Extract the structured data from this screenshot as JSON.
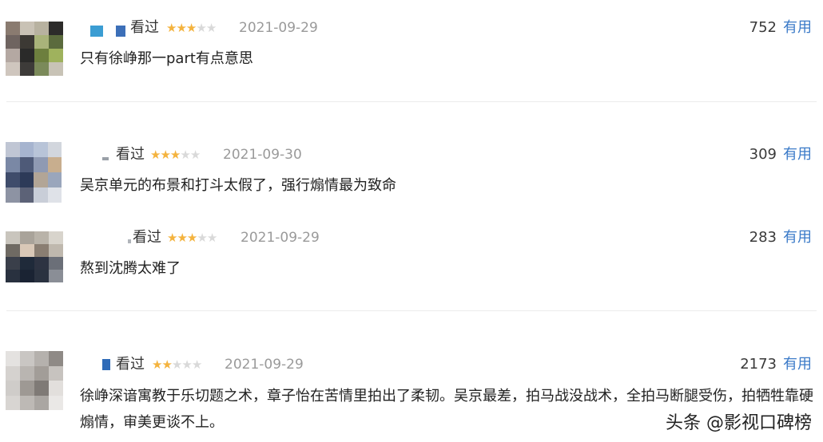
{
  "reviews": [
    {
      "status": "看过",
      "rating": 3,
      "max_rating": 5,
      "date": "2021-09-29",
      "votes": "752",
      "useful_label": "有用",
      "content": "只有徐峥那一part有点意思",
      "avatar_colors": [
        "#8a7b70",
        "#c9c2b5",
        "#b8b2a0",
        "#2c2b2a",
        "#6f6460",
        "#3c3934",
        "#a9b37a",
        "#5b6b3d",
        "#b4a8a2",
        "#2a2a29",
        "#6d7f3e",
        "#9fb25d",
        "#cfc6be",
        "#3d3b39",
        "#7b8a5a",
        "#c8c3b6"
      ]
    },
    {
      "status": "看过",
      "rating": 3,
      "max_rating": 5,
      "date": "2021-09-30",
      "votes": "309",
      "useful_label": "有用",
      "content": "吴京单元的布景和打斗太假了，强行煽情最为致命",
      "avatar_colors": [
        "#c0c6d4",
        "#a6b4cf",
        "#b8c4d8",
        "#d2d6dd",
        "#7a88a5",
        "#4e5a78",
        "#8f9ab3",
        "#c8ae8e",
        "#3f4c6b",
        "#2d3a58",
        "#b2a596",
        "#9aa6bc",
        "#8d93a3",
        "#5c6277",
        "#c9ced8",
        "#dfe2e8"
      ]
    },
    {
      "status": "看过",
      "rating": 3,
      "max_rating": 5,
      "date": "2021-09-29",
      "votes": "283",
      "useful_label": "有用",
      "content": "熬到沈腾太难了",
      "avatar_colors": [
        "#c9c5bd",
        "#a9a39a",
        "#b9b3a9",
        "#d8d4cc",
        "#6f6a63",
        "#d9c8b7",
        "#8a7e72",
        "#bfb8ae",
        "#3a3f4a",
        "#1f2a3a",
        "#2d3342",
        "#6b6f78",
        "#29313f",
        "#1a2333",
        "#2a3240",
        "#8a8e96"
      ]
    },
    {
      "status": "看过",
      "rating": 2,
      "max_rating": 5,
      "date": "2021-09-29",
      "votes": "2173",
      "useful_label": "有用",
      "content": "徐峥深谙寓教于乐切题之术，章子怡在苦情里拍出了柔韧。吴京最差，拍马战没战术，全拍马断腿受伤，拍牺牲靠硬煽情，审美更谈不上。",
      "avatar_colors": [
        "#e4e2e0",
        "#c9c6c3",
        "#b5b1ad",
        "#8f8a86",
        "#d5d2cf",
        "#b9b5b1",
        "#a29d98",
        "#c7c3bf",
        "#cfccc9",
        "#9e9994",
        "#7f7a76",
        "#e2dfdc",
        "#d8d5d2",
        "#bdb9b5",
        "#aaa6a2",
        "#eae8e6"
      ]
    }
  ],
  "watermark": "头条 @影视口碑榜",
  "colors": {
    "star_on": "#f4b33e",
    "star_off": "#d9d9d9",
    "useful_link": "#3a7ac8",
    "date": "#9a9a9a"
  }
}
